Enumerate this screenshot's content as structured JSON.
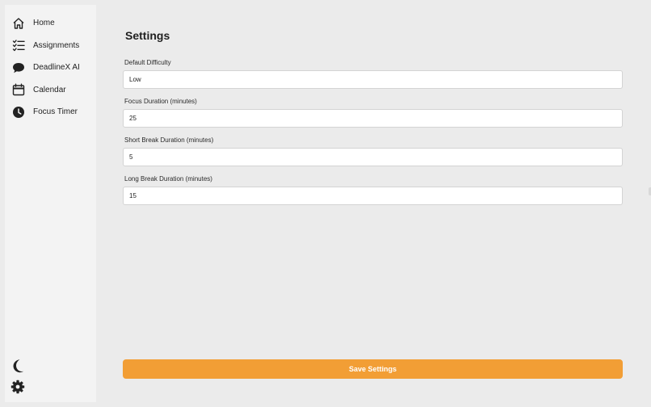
{
  "sidebar": {
    "items": [
      {
        "label": "Home",
        "icon": "home-icon"
      },
      {
        "label": "Assignments",
        "icon": "checklist-icon"
      },
      {
        "label": "DeadlineX AI",
        "icon": "chat-bubble-icon"
      },
      {
        "label": "Calendar",
        "icon": "calendar-icon"
      },
      {
        "label": "Focus Timer",
        "icon": "clock-icon"
      }
    ],
    "bottom_icons": [
      "moon-icon",
      "gear-icon"
    ]
  },
  "main": {
    "title": "Settings",
    "fields": [
      {
        "label": "Default Difficulty",
        "value": "Low"
      },
      {
        "label": "Focus Duration (minutes)",
        "value": "25"
      },
      {
        "label": "Short Break Duration (minutes)",
        "value": "5"
      },
      {
        "label": "Long Break Duration (minutes)",
        "value": "15"
      }
    ],
    "save_label": "Save Settings"
  },
  "colors": {
    "background": "#ebebeb",
    "sidebar": "#f3f3f3",
    "accent": "#f29e35",
    "text": "#1f1f1f"
  }
}
